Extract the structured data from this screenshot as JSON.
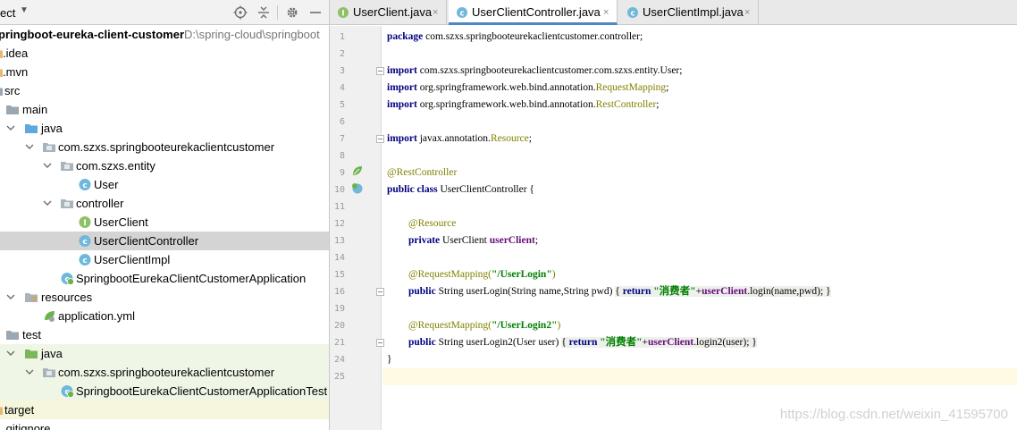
{
  "project_panel": {
    "title": "ect",
    "tree": [
      {
        "label": "pringboot-eureka-client-customer",
        "path": "D:\\spring-cloud\\springboot",
        "bold": true,
        "icon": "module-folder-icon"
      },
      {
        "label": ".idea",
        "icon": "folder-icon"
      },
      {
        "label": ".mvn",
        "icon": "folder-icon"
      },
      {
        "label": "src",
        "icon": "folder-icon"
      },
      {
        "label": "main",
        "icon": "folder-icon"
      },
      {
        "label": "java",
        "icon": "source-folder-icon"
      },
      {
        "label": "com.szxs.springbooteurekaclientcustomer",
        "icon": "package-icon"
      },
      {
        "label": "com.szxs.entity",
        "icon": "package-icon"
      },
      {
        "label": "User",
        "icon": "class-icon"
      },
      {
        "label": "controller",
        "icon": "package-icon"
      },
      {
        "label": "UserClient",
        "icon": "interface-icon"
      },
      {
        "label": "UserClientController",
        "icon": "class-icon"
      },
      {
        "label": "UserClientImpl",
        "icon": "class-icon"
      },
      {
        "label": "SpringbootEurekaClientCustomerApplication",
        "icon": "spring-boot-class-icon"
      },
      {
        "label": "resources",
        "icon": "resources-folder-icon"
      },
      {
        "label": "application.yml",
        "icon": "spring-yml-icon"
      },
      {
        "label": "test",
        "icon": "folder-icon"
      },
      {
        "label": "java",
        "icon": "test-source-folder-icon"
      },
      {
        "label": "com.szxs.springbooteurekaclientcustomer",
        "icon": "package-icon"
      },
      {
        "label": "SpringbootEurekaClientCustomerApplicationTest",
        "icon": "spring-boot-class-icon"
      },
      {
        "label": "target",
        "icon": "excluded-folder-icon"
      },
      {
        "label": ".gitignore",
        "icon": "file-icon"
      }
    ],
    "selected_item": "UserClientController"
  },
  "editor": {
    "tabs": [
      {
        "label": "UserClient.java",
        "icon": "interface-icon",
        "active": false
      },
      {
        "label": "UserClientController.java",
        "icon": "class-icon",
        "active": true
      },
      {
        "label": "UserClientImpl.java",
        "icon": "class-icon",
        "active": false
      }
    ],
    "close_glyph": "×",
    "line_numbers": [
      "1",
      "2",
      "3",
      "4",
      "5",
      "6",
      "7",
      "8",
      "9",
      "10",
      "11",
      "12",
      "13",
      "14",
      "15",
      "16",
      "19",
      "20",
      "21",
      "24",
      "25"
    ],
    "code": {
      "l1_kw": "package",
      "l1_rest": " com.szxs.springbooteurekaclientcustomer.controller;",
      "l3_kw": "import",
      "l3_rest": " com.szxs.springbooteurekaclientcustomer.com.szxs.entity.User;",
      "l4_kw": "import",
      "l4_rest": " org.springframework.web.bind.annotation.",
      "l4_cls": "RequestMapping",
      "l4_end": ";",
      "l5_kw": "import",
      "l5_rest": " org.springframework.web.bind.annotation.",
      "l5_cls": "RestController",
      "l5_end": ";",
      "l7_kw": "import",
      "l7_rest": " javax.annotation.",
      "l7_cls": "Resource",
      "l7_end": ";",
      "l9_ann": "@RestController",
      "l10_kw": "public class",
      "l10_rest": " UserClientController {",
      "l12_ann": "@Resource",
      "l13_kw": "private",
      "l13_rest": " UserClient ",
      "l13_fld": "userClient",
      "l13_end": ";",
      "l15_ann": "@RequestMapping(",
      "l15_str": "\"/UserLogin\"",
      "l15_end": ")",
      "l16_kw": "public",
      "l16_rest": " String userLogin(String name,String pwd) ",
      "l16_fold_open": "{ ",
      "l16_fold_kw": "return",
      "l16_fold_str": " \"消费者\"",
      "l16_fold_plus": "+",
      "l16_fold_fld": "userClient",
      "l16_fold_rest": ".login(name,pwd); }",
      "l19_ann": "@RequestMapping(",
      "l19_str": "\"/UserLogin2\"",
      "l19_end": ")",
      "l20_kw": "public",
      "l20_rest": " String userLogin2(User user) ",
      "l20_fold_open": "{ ",
      "l20_fold_kw": "return",
      "l20_fold_str": " \"消费者\"",
      "l20_fold_plus": "+",
      "l20_fold_fld": "userClient",
      "l20_fold_rest": ".login2(user); }",
      "l21_text": "}"
    }
  },
  "watermark": "https://blog.csdn.net/weixin_41595700",
  "colors": {
    "selection": "#d4d4d4",
    "keyword": "#000080",
    "annotation": "#808000",
    "field": "#660e7a",
    "string": "#008000",
    "active_tab_underline": "#4a88c7"
  }
}
